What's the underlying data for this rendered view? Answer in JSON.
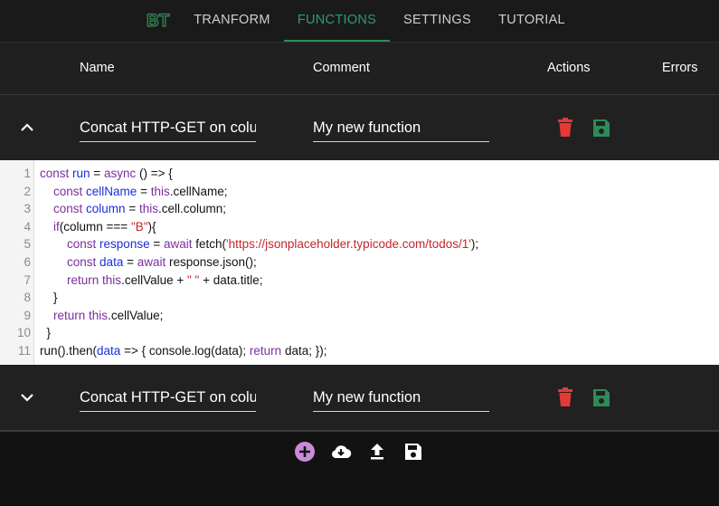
{
  "nav": {
    "logo_text": "BT",
    "tabs": [
      "TRANFORM",
      "FUNCTIONS",
      "SETTINGS",
      "TUTORIAL"
    ],
    "active_tab": "FUNCTIONS",
    "accent_color": "#2e9d6b"
  },
  "table": {
    "headers": {
      "name": "Name",
      "comment": "Comment",
      "actions": "Actions",
      "errors": "Errors"
    }
  },
  "functions": [
    {
      "expanded": true,
      "toggle_icon": "chevron-up-icon",
      "name": "Concat HTTP-GET on column B",
      "comment": "My new function",
      "actions": [
        "delete-icon",
        "save-icon"
      ]
    },
    {
      "expanded": false,
      "toggle_icon": "chevron-down-icon",
      "name": "Concat HTTP-GET on column B",
      "comment": "My new function",
      "actions": [
        "delete-icon",
        "save-icon"
      ]
    }
  ],
  "editor": {
    "line_numbers": [
      "1",
      "2",
      "3",
      "4",
      "5",
      "6",
      "7",
      "8",
      "9",
      "10",
      "11"
    ],
    "lines": [
      [
        [
          "kw",
          "const "
        ],
        [
          "var",
          "run"
        ],
        [
          "t",
          " = "
        ],
        [
          "kw",
          "async"
        ],
        [
          "t",
          " () => {"
        ]
      ],
      [
        [
          "t",
          "    "
        ],
        [
          "kw",
          "const "
        ],
        [
          "var",
          "cellName"
        ],
        [
          "t",
          " = "
        ],
        [
          "kw",
          "this"
        ],
        [
          "t",
          ".cellName;"
        ]
      ],
      [
        [
          "t",
          "    "
        ],
        [
          "kw",
          "const "
        ],
        [
          "var",
          "column"
        ],
        [
          "t",
          " = "
        ],
        [
          "kw",
          "this"
        ],
        [
          "t",
          ".cell.column;"
        ]
      ],
      [
        [
          "t",
          "    "
        ],
        [
          "kw",
          "if"
        ],
        [
          "t",
          "(column === "
        ],
        [
          "str",
          "\"B\""
        ],
        [
          "t",
          "){"
        ]
      ],
      [
        [
          "t",
          "        "
        ],
        [
          "kw",
          "const "
        ],
        [
          "var",
          "response"
        ],
        [
          "t",
          " = "
        ],
        [
          "kw",
          "await"
        ],
        [
          "t",
          " fetch("
        ],
        [
          "str",
          "'https://jsonplaceholder.typicode.com/todos/1'"
        ],
        [
          "t",
          ");"
        ]
      ],
      [
        [
          "t",
          "        "
        ],
        [
          "kw",
          "const "
        ],
        [
          "var",
          "data"
        ],
        [
          "t",
          " = "
        ],
        [
          "kw",
          "await"
        ],
        [
          "t",
          " response.json();"
        ]
      ],
      [
        [
          "t",
          "        "
        ],
        [
          "kw",
          "return "
        ],
        [
          "kw",
          "this"
        ],
        [
          "t",
          ".cellValue + "
        ],
        [
          "str",
          "\" \""
        ],
        [
          "t",
          " + data.title;"
        ]
      ],
      [
        [
          "t",
          "    }"
        ]
      ],
      [
        [
          "t",
          "    "
        ],
        [
          "kw",
          "return "
        ],
        [
          "kw",
          "this"
        ],
        [
          "t",
          ".cellValue;"
        ]
      ],
      [
        [
          "t",
          "  }"
        ]
      ],
      [
        [
          "t",
          "run().then("
        ],
        [
          "var",
          "data"
        ],
        [
          "t",
          " => { console.log(data); "
        ],
        [
          "kw",
          "return"
        ],
        [
          "t",
          " data; });"
        ]
      ]
    ]
  },
  "bottom_actions": [
    {
      "icon": "add-icon",
      "color": "#c98ad6"
    },
    {
      "icon": "cloud-download-icon",
      "color": "#ffffff"
    },
    {
      "icon": "upload-icon",
      "color": "#ffffff"
    },
    {
      "icon": "save-icon",
      "color": "#ffffff"
    }
  ],
  "colors": {
    "delete": "#e53935",
    "save": "#2e8b57"
  }
}
